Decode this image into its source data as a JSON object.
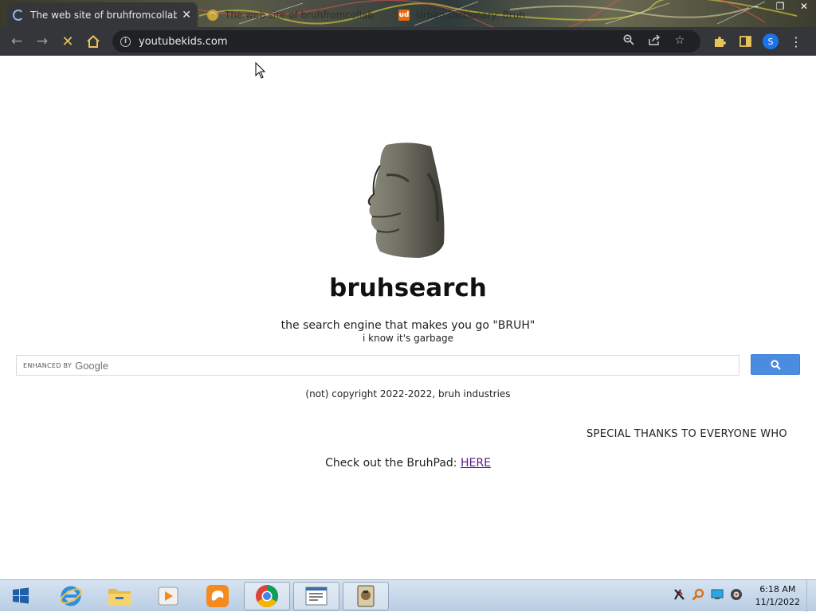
{
  "browser": {
    "tabs": [
      {
        "title": "The web site of bruhfromcollab",
        "active": true,
        "loading": true
      },
      {
        "title": "The web site of bruhfromcollab",
        "active": false,
        "favicon": "uc-browser-icon"
      },
      {
        "title": "Urban Dictionary: Bruh",
        "active": false,
        "favicon": "ud"
      }
    ],
    "window_controls": {
      "minimize": "–",
      "maximize": "❐",
      "close": "✕"
    },
    "address": "youtubekids.com",
    "accent_loading_color": "#e8c35c",
    "profile_initial": "S"
  },
  "page": {
    "title": "bruhsearch",
    "tagline": "the search engine that makes you go \"BRUH\"",
    "subtagline": "i know it's garbage",
    "search": {
      "enhanced_label": "ENHANCED BY",
      "google_label": "Google",
      "button_color": "#4a8ce0"
    },
    "copyright": "(not) copyright 2022-2022, bruh industries",
    "marquee": "SPECIAL THANKS TO EVERYONE WHO",
    "bruhpad_text": "Check out the BruhPad:",
    "bruhpad_link": "HERE"
  },
  "taskbar": {
    "apps": [
      "start-button",
      "internet-explorer-icon",
      "file-explorer-icon",
      "media-player-icon",
      "uc-browser-icon",
      "chrome-icon",
      "notepad-window-icon",
      "app-window-icon"
    ],
    "time": "6:18 AM",
    "date": "11/1/2022"
  }
}
